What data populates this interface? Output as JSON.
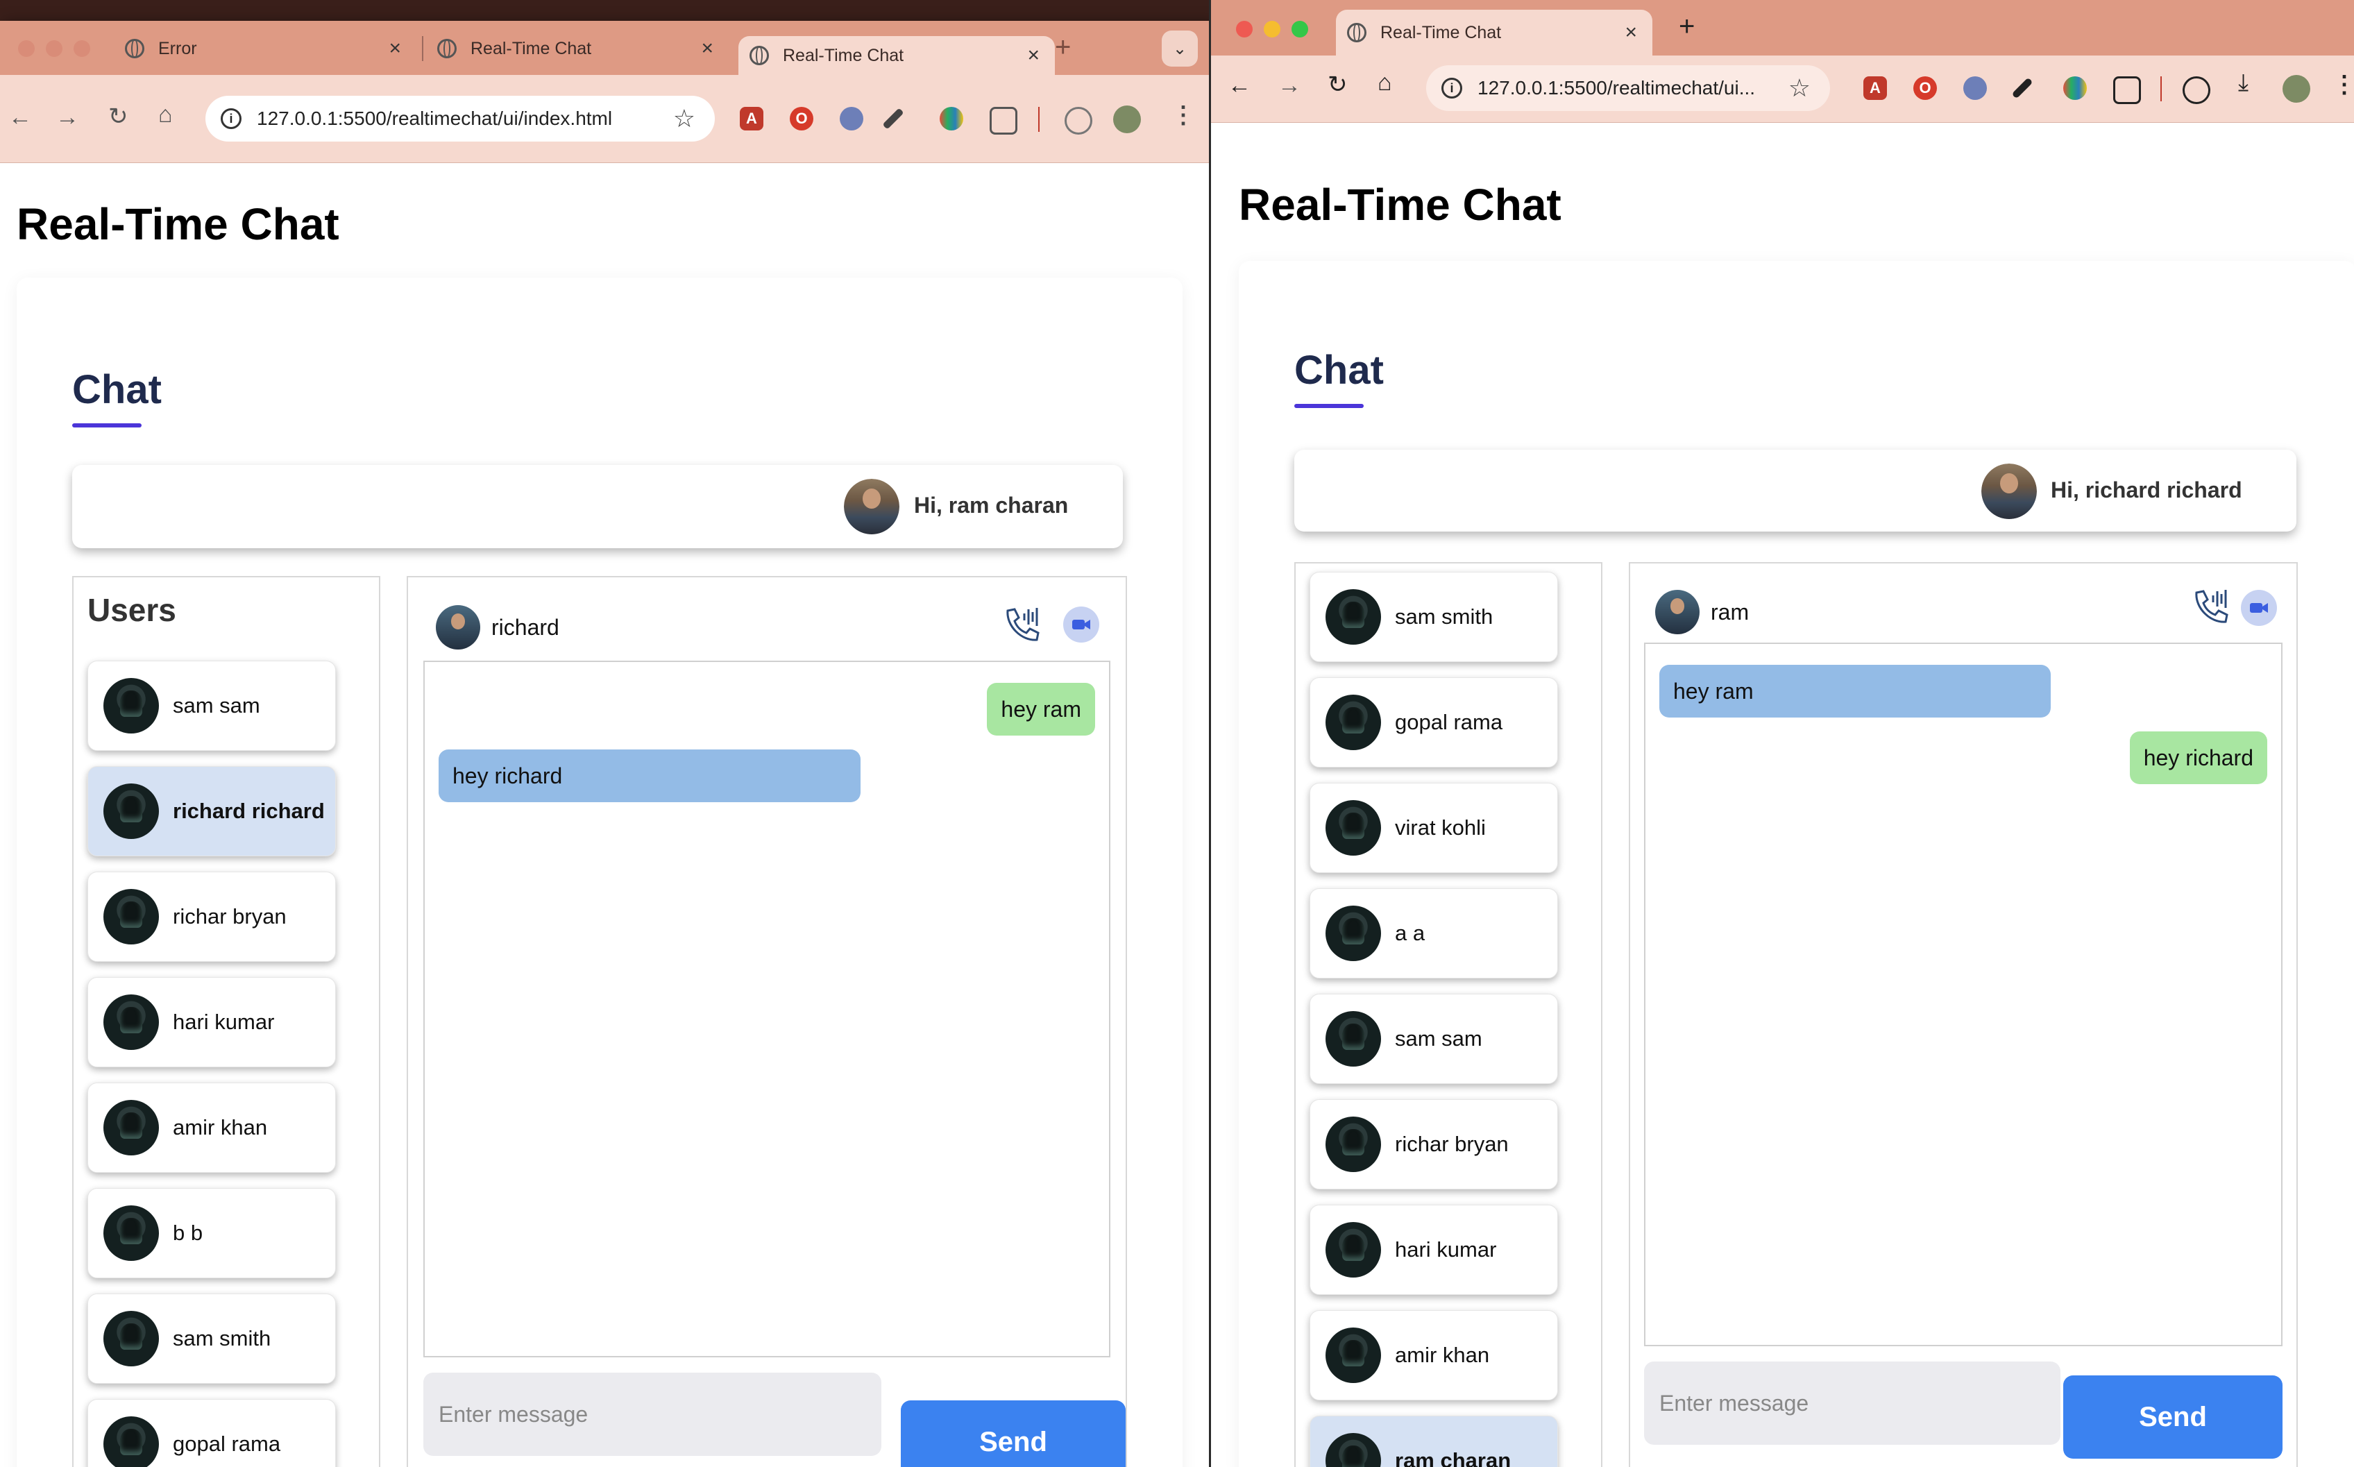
{
  "left_window": {
    "tabs": [
      {
        "title": "Error"
      },
      {
        "title": "Real-Time Chat"
      },
      {
        "title": "Real-Time Chat"
      }
    ],
    "url": "127.0.0.1:5500/realtimechat/ui/index.html",
    "page_title": "Real-Time Chat",
    "chat_heading": "Chat",
    "greeting": "Hi, ram charan",
    "users_title": "Users",
    "users": [
      {
        "name": "sam sam"
      },
      {
        "name": "richard richard"
      },
      {
        "name": "richar bryan"
      },
      {
        "name": "hari kumar"
      },
      {
        "name": "amir khan"
      },
      {
        "name": "b b"
      },
      {
        "name": "sam smith"
      },
      {
        "name": "gopal rama"
      }
    ],
    "active_user": "richard richard",
    "chat_partner": "richard",
    "messages": [
      {
        "text": "hey ram",
        "side": "sent"
      },
      {
        "text": "hey richard",
        "side": "received"
      }
    ],
    "input_placeholder": "Enter message",
    "send_label": "Send"
  },
  "right_window": {
    "tabs": [
      {
        "title": "Real-Time Chat"
      }
    ],
    "url": "127.0.0.1:5500/realtimechat/ui...",
    "page_title": "Real-Time Chat",
    "chat_heading": "Chat",
    "greeting": "Hi, richard richard",
    "users": [
      {
        "name": "sam smith"
      },
      {
        "name": "gopal rama"
      },
      {
        "name": "virat kohli"
      },
      {
        "name": "a a"
      },
      {
        "name": "sam sam"
      },
      {
        "name": "richar bryan"
      },
      {
        "name": "hari kumar"
      },
      {
        "name": "amir khan"
      },
      {
        "name": "ram charan"
      }
    ],
    "active_user": "ram charan",
    "chat_partner": "ram",
    "messages": [
      {
        "text": "hey ram",
        "side": "received"
      },
      {
        "text": "hey richard",
        "side": "sent"
      }
    ],
    "input_placeholder": "Enter message",
    "send_label": "Send"
  },
  "icons": {
    "back": "←",
    "forward": "→",
    "reload": "↻",
    "home": "⌂",
    "star": "☆",
    "close": "×",
    "new_tab": "+",
    "dropdown": "⌄",
    "menu": "⋮",
    "info": "i"
  },
  "colors": {
    "tab_bar": "#de9a84",
    "toolbar": "#f6d9cf",
    "heading": "#1f2a4d",
    "accent_underline": "#4b35d9",
    "sent_bubble": "#a8e6a1",
    "received_bubble": "#93bbe6",
    "active_user_bg": "#d5e1f3",
    "send_button": "#3b82f0"
  }
}
